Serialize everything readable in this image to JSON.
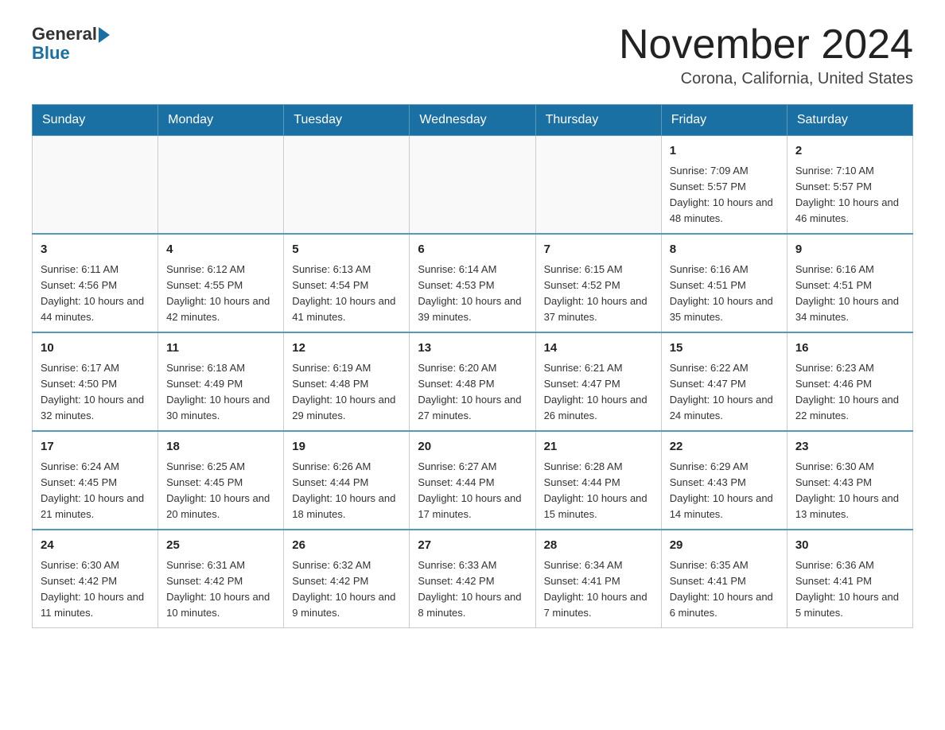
{
  "logo": {
    "general": "General",
    "blue": "Blue"
  },
  "title": "November 2024",
  "location": "Corona, California, United States",
  "days_of_week": [
    "Sunday",
    "Monday",
    "Tuesday",
    "Wednesday",
    "Thursday",
    "Friday",
    "Saturday"
  ],
  "weeks": [
    [
      {
        "day": "",
        "info": ""
      },
      {
        "day": "",
        "info": ""
      },
      {
        "day": "",
        "info": ""
      },
      {
        "day": "",
        "info": ""
      },
      {
        "day": "",
        "info": ""
      },
      {
        "day": "1",
        "info": "Sunrise: 7:09 AM\nSunset: 5:57 PM\nDaylight: 10 hours and 48 minutes."
      },
      {
        "day": "2",
        "info": "Sunrise: 7:10 AM\nSunset: 5:57 PM\nDaylight: 10 hours and 46 minutes."
      }
    ],
    [
      {
        "day": "3",
        "info": "Sunrise: 6:11 AM\nSunset: 4:56 PM\nDaylight: 10 hours and 44 minutes."
      },
      {
        "day": "4",
        "info": "Sunrise: 6:12 AM\nSunset: 4:55 PM\nDaylight: 10 hours and 42 minutes."
      },
      {
        "day": "5",
        "info": "Sunrise: 6:13 AM\nSunset: 4:54 PM\nDaylight: 10 hours and 41 minutes."
      },
      {
        "day": "6",
        "info": "Sunrise: 6:14 AM\nSunset: 4:53 PM\nDaylight: 10 hours and 39 minutes."
      },
      {
        "day": "7",
        "info": "Sunrise: 6:15 AM\nSunset: 4:52 PM\nDaylight: 10 hours and 37 minutes."
      },
      {
        "day": "8",
        "info": "Sunrise: 6:16 AM\nSunset: 4:51 PM\nDaylight: 10 hours and 35 minutes."
      },
      {
        "day": "9",
        "info": "Sunrise: 6:16 AM\nSunset: 4:51 PM\nDaylight: 10 hours and 34 minutes."
      }
    ],
    [
      {
        "day": "10",
        "info": "Sunrise: 6:17 AM\nSunset: 4:50 PM\nDaylight: 10 hours and 32 minutes."
      },
      {
        "day": "11",
        "info": "Sunrise: 6:18 AM\nSunset: 4:49 PM\nDaylight: 10 hours and 30 minutes."
      },
      {
        "day": "12",
        "info": "Sunrise: 6:19 AM\nSunset: 4:48 PM\nDaylight: 10 hours and 29 minutes."
      },
      {
        "day": "13",
        "info": "Sunrise: 6:20 AM\nSunset: 4:48 PM\nDaylight: 10 hours and 27 minutes."
      },
      {
        "day": "14",
        "info": "Sunrise: 6:21 AM\nSunset: 4:47 PM\nDaylight: 10 hours and 26 minutes."
      },
      {
        "day": "15",
        "info": "Sunrise: 6:22 AM\nSunset: 4:47 PM\nDaylight: 10 hours and 24 minutes."
      },
      {
        "day": "16",
        "info": "Sunrise: 6:23 AM\nSunset: 4:46 PM\nDaylight: 10 hours and 22 minutes."
      }
    ],
    [
      {
        "day": "17",
        "info": "Sunrise: 6:24 AM\nSunset: 4:45 PM\nDaylight: 10 hours and 21 minutes."
      },
      {
        "day": "18",
        "info": "Sunrise: 6:25 AM\nSunset: 4:45 PM\nDaylight: 10 hours and 20 minutes."
      },
      {
        "day": "19",
        "info": "Sunrise: 6:26 AM\nSunset: 4:44 PM\nDaylight: 10 hours and 18 minutes."
      },
      {
        "day": "20",
        "info": "Sunrise: 6:27 AM\nSunset: 4:44 PM\nDaylight: 10 hours and 17 minutes."
      },
      {
        "day": "21",
        "info": "Sunrise: 6:28 AM\nSunset: 4:44 PM\nDaylight: 10 hours and 15 minutes."
      },
      {
        "day": "22",
        "info": "Sunrise: 6:29 AM\nSunset: 4:43 PM\nDaylight: 10 hours and 14 minutes."
      },
      {
        "day": "23",
        "info": "Sunrise: 6:30 AM\nSunset: 4:43 PM\nDaylight: 10 hours and 13 minutes."
      }
    ],
    [
      {
        "day": "24",
        "info": "Sunrise: 6:30 AM\nSunset: 4:42 PM\nDaylight: 10 hours and 11 minutes."
      },
      {
        "day": "25",
        "info": "Sunrise: 6:31 AM\nSunset: 4:42 PM\nDaylight: 10 hours and 10 minutes."
      },
      {
        "day": "26",
        "info": "Sunrise: 6:32 AM\nSunset: 4:42 PM\nDaylight: 10 hours and 9 minutes."
      },
      {
        "day": "27",
        "info": "Sunrise: 6:33 AM\nSunset: 4:42 PM\nDaylight: 10 hours and 8 minutes."
      },
      {
        "day": "28",
        "info": "Sunrise: 6:34 AM\nSunset: 4:41 PM\nDaylight: 10 hours and 7 minutes."
      },
      {
        "day": "29",
        "info": "Sunrise: 6:35 AM\nSunset: 4:41 PM\nDaylight: 10 hours and 6 minutes."
      },
      {
        "day": "30",
        "info": "Sunrise: 6:36 AM\nSunset: 4:41 PM\nDaylight: 10 hours and 5 minutes."
      }
    ]
  ]
}
